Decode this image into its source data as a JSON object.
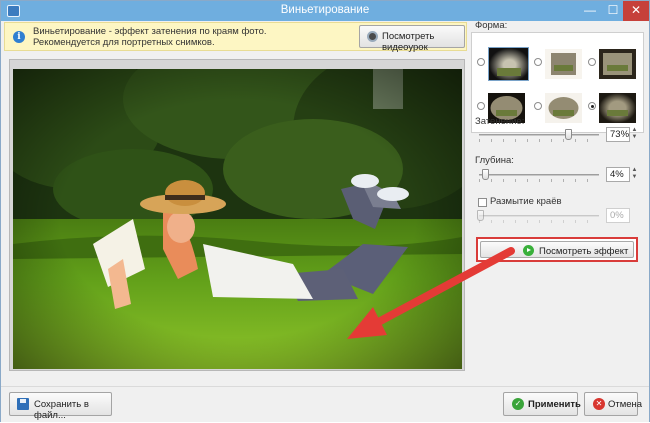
{
  "window": {
    "title": "Виньетирование",
    "controls": {
      "minimize": "—",
      "maximize": "☐",
      "close": "✕"
    }
  },
  "info": {
    "icon": "info-icon",
    "line1": "Виньетирование - эффект затенения по краям фото.",
    "line2": "Рекомендуется для портретных снимков.",
    "video_button": "Посмотреть видеоурок"
  },
  "shape": {
    "label": "Форма:",
    "selected_index": 5,
    "options": [
      "vignette-soft-dark",
      "vignette-light",
      "vignette-corners",
      "vignette-rounded-dark",
      "vignette-rounded-light",
      "vignette-rounded-dark-strong"
    ]
  },
  "shading": {
    "label": "Затенение:",
    "value": "73%",
    "level": 0.73
  },
  "depth": {
    "label": "Глубина:",
    "value": "4%",
    "level": 0.04
  },
  "blur": {
    "label": "Размытие краёв",
    "checked": false,
    "value": "0%",
    "level": 0
  },
  "preview_button": "Посмотреть эффект",
  "footer": {
    "save": "Сохранить в файл...",
    "apply": "Применить",
    "cancel": "Отмена"
  },
  "colors": {
    "titlebar": "#6faedf",
    "highlight": "#d93c3a",
    "accent_green": "#39b03a"
  }
}
